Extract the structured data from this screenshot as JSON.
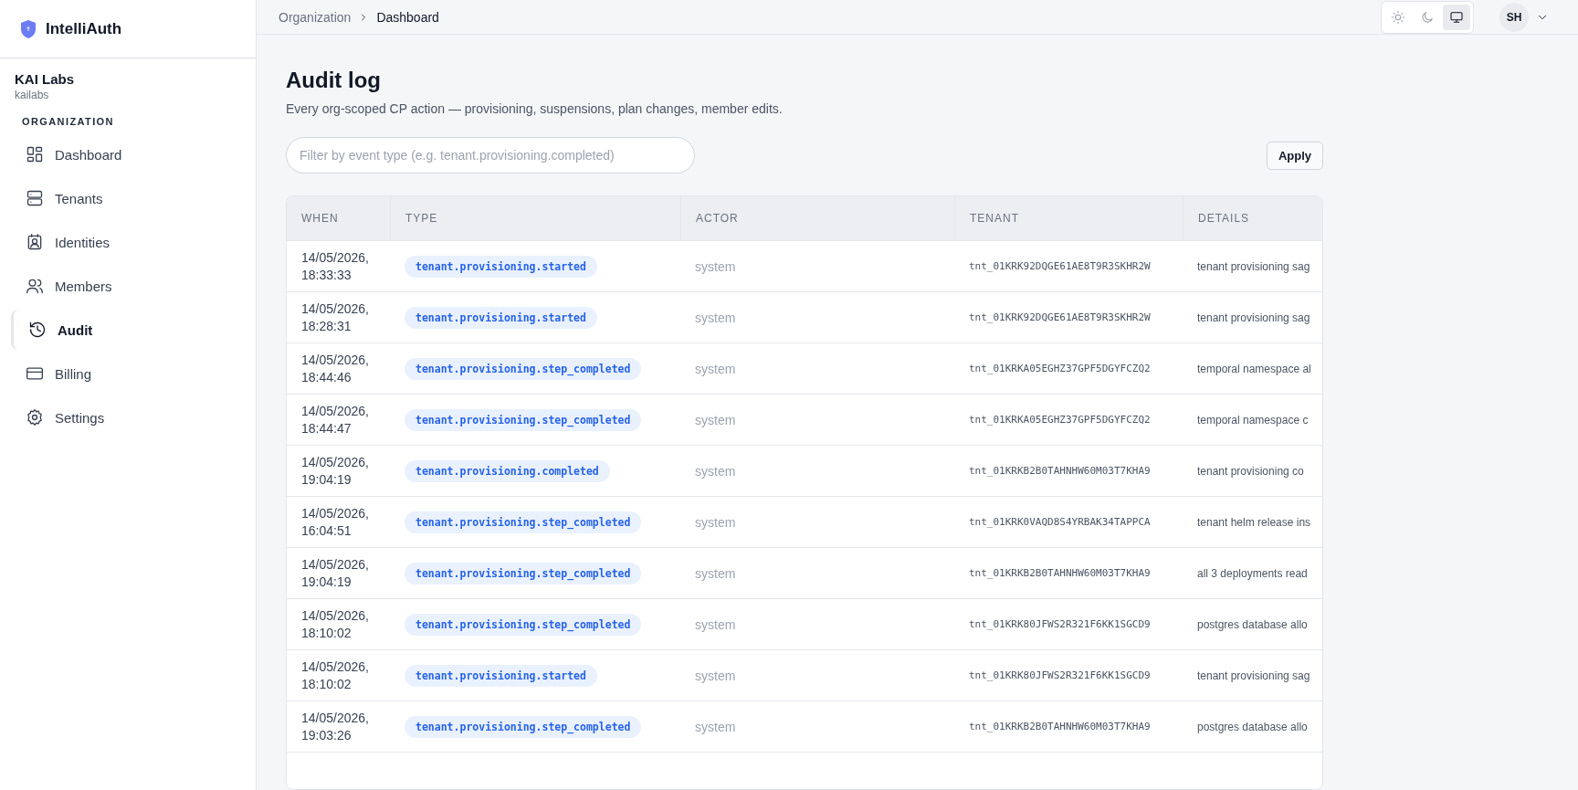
{
  "app": {
    "name": "IntelliAuth"
  },
  "organization": {
    "name": "KAI Labs",
    "slug": "kailabs"
  },
  "sidebar": {
    "section_title": "ORGANIZATION",
    "items": [
      {
        "label": "Dashboard",
        "kind": "dashboard",
        "selected": false
      },
      {
        "label": "Tenants",
        "kind": "tenants",
        "selected": false
      },
      {
        "label": "Identities",
        "kind": "identities",
        "selected": false
      },
      {
        "label": "Members",
        "kind": "members",
        "selected": false
      },
      {
        "label": "Audit",
        "kind": "audit",
        "selected": true
      },
      {
        "label": "Billing",
        "kind": "billing",
        "selected": false
      },
      {
        "label": "Settings",
        "kind": "settings",
        "selected": false
      }
    ]
  },
  "breadcrumb": [
    "Organization",
    "Dashboard"
  ],
  "theme_options": [
    {
      "kind": "light",
      "selected": false
    },
    {
      "kind": "dark",
      "selected": false
    },
    {
      "kind": "system",
      "selected": true
    }
  ],
  "user": {
    "initials": "SH"
  },
  "page": {
    "title": "Audit log",
    "subtitle": "Every org-scoped CP action — provisioning, suspensions, plan changes, member edits."
  },
  "filter": {
    "placeholder": "Filter by event type (e.g. tenant.provisioning.completed)",
    "button": "Apply"
  },
  "table": {
    "columns": [
      "WHEN",
      "TYPE",
      "ACTOR",
      "TENANT",
      "DETAILS"
    ],
    "rows": [
      {
        "when": "14/05/2026,\n18:33:33",
        "type": "tenant.provisioning.started",
        "actor": "system",
        "tenant": "tnt_01KRK92DQGE61AE8T9R3SKHR2W",
        "details": "tenant provisioning sag"
      },
      {
        "when": "14/05/2026,\n18:28:31",
        "type": "tenant.provisioning.started",
        "actor": "system",
        "tenant": "tnt_01KRK92DQGE61AE8T9R3SKHR2W",
        "details": "tenant provisioning sag"
      },
      {
        "when": "14/05/2026,\n18:44:46",
        "type": "tenant.provisioning.step_completed",
        "actor": "system",
        "tenant": "tnt_01KRKA05EGHZ37GPF5DGYFCZQ2",
        "details": "temporal namespace al"
      },
      {
        "when": "14/05/2026,\n18:44:47",
        "type": "tenant.provisioning.step_completed",
        "actor": "system",
        "tenant": "tnt_01KRKA05EGHZ37GPF5DGYFCZQ2",
        "details": "temporal namespace c"
      },
      {
        "when": "14/05/2026,\n19:04:19",
        "type": "tenant.provisioning.completed",
        "actor": "system",
        "tenant": "tnt_01KRKB2B0TAHNHW60M03T7KHA9",
        "details": "tenant provisioning co"
      },
      {
        "when": "14/05/2026,\n16:04:51",
        "type": "tenant.provisioning.step_completed",
        "actor": "system",
        "tenant": "tnt_01KRK0VAQD8S4YRBAK34TAPPCA",
        "details": "tenant helm release ins"
      },
      {
        "when": "14/05/2026,\n19:04:19",
        "type": "tenant.provisioning.step_completed",
        "actor": "system",
        "tenant": "tnt_01KRKB2B0TAHNHW60M03T7KHA9",
        "details": "all 3 deployments read"
      },
      {
        "when": "14/05/2026,\n18:10:02",
        "type": "tenant.provisioning.step_completed",
        "actor": "system",
        "tenant": "tnt_01KRK80JFWS2R321F6KK1SGCD9",
        "details": "postgres database allo"
      },
      {
        "when": "14/05/2026,\n18:10:02",
        "type": "tenant.provisioning.started",
        "actor": "system",
        "tenant": "tnt_01KRK80JFWS2R321F6KK1SGCD9",
        "details": "tenant provisioning sag"
      },
      {
        "when": "14/05/2026,\n19:03:26",
        "type": "tenant.provisioning.step_completed",
        "actor": "system",
        "tenant": "tnt_01KRKB2B0TAHNHW60M03T7KHA9",
        "details": "postgres database allo"
      }
    ]
  }
}
